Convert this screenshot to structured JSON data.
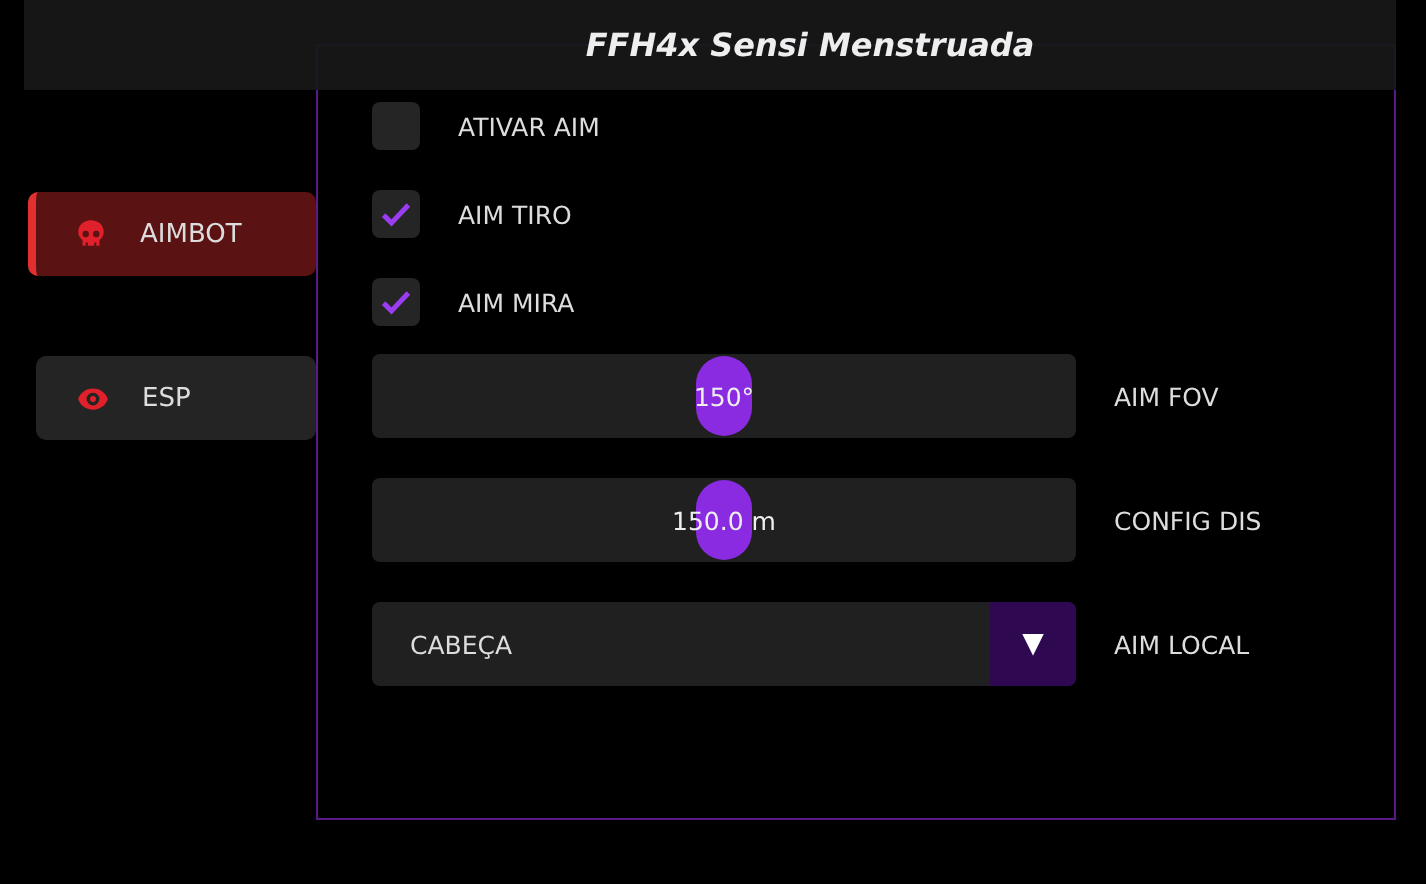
{
  "window": {
    "title": "FFH4x Sensi Menstruada"
  },
  "sidebar": {
    "items": [
      {
        "label": "AIMBOT",
        "kind": "skull",
        "selected": true
      },
      {
        "label": "ESP",
        "kind": "eye",
        "selected": false
      }
    ]
  },
  "checkboxes": [
    {
      "label": "ATIVAR AIM",
      "checked": false
    },
    {
      "label": "AIM TIRO",
      "checked": true
    },
    {
      "label": "AIM MIRA",
      "checked": true
    }
  ],
  "sliders": [
    {
      "label": "AIM FOV",
      "reading": "150°",
      "level": 0.5
    },
    {
      "label": "CONFIG DIS",
      "reading": "150.0 m",
      "level": 0.5
    }
  ],
  "dropdown": {
    "label": "AIM LOCAL",
    "value": "CABEÇA",
    "arrow": "▼"
  }
}
